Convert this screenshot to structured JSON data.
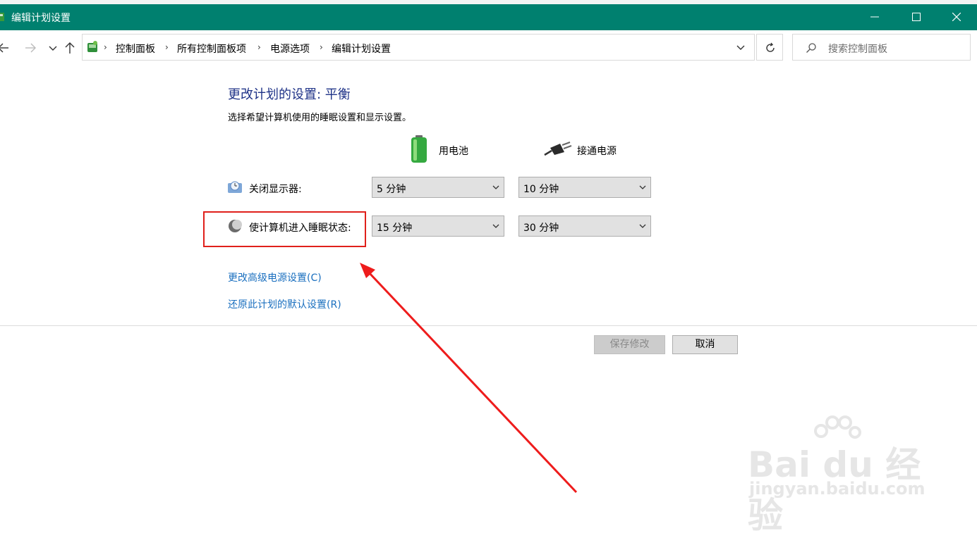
{
  "window": {
    "title": "编辑计划设置",
    "title_bar_color": "#00806f"
  },
  "address": {
    "breadcrumbs": [
      "控制面板",
      "所有控制面板项",
      "电源选项",
      "编辑计划设置"
    ],
    "separator": "›",
    "search_placeholder": "搜索控制面板"
  },
  "content": {
    "heading": "更改计划的设置: 平衡",
    "subtitle": "选择希望计算机使用的睡眠设置和显示设置。",
    "col_battery": "用电池",
    "col_plugged": "接通电源",
    "rows": [
      {
        "label": "关闭显示器:",
        "battery": "5 分钟",
        "plugged": "10 分钟",
        "icon": "display-icon"
      },
      {
        "label": "使计算机进入睡眠状态:",
        "battery": "15 分钟",
        "plugged": "30 分钟",
        "icon": "sleep-moon-icon"
      }
    ],
    "link_advanced": "更改高级电源设置(C)",
    "link_restore": "还原此计划的默认设置(R)",
    "link_color": "#1a6fbf",
    "heading_color": "#1e3287"
  },
  "buttons": {
    "save": "保存修改",
    "cancel": "取消"
  },
  "annotation": {
    "highlight_color": "#e0201b"
  },
  "watermark": {
    "main": "Bai du 经验",
    "url": "jingyan.baidu.com"
  }
}
